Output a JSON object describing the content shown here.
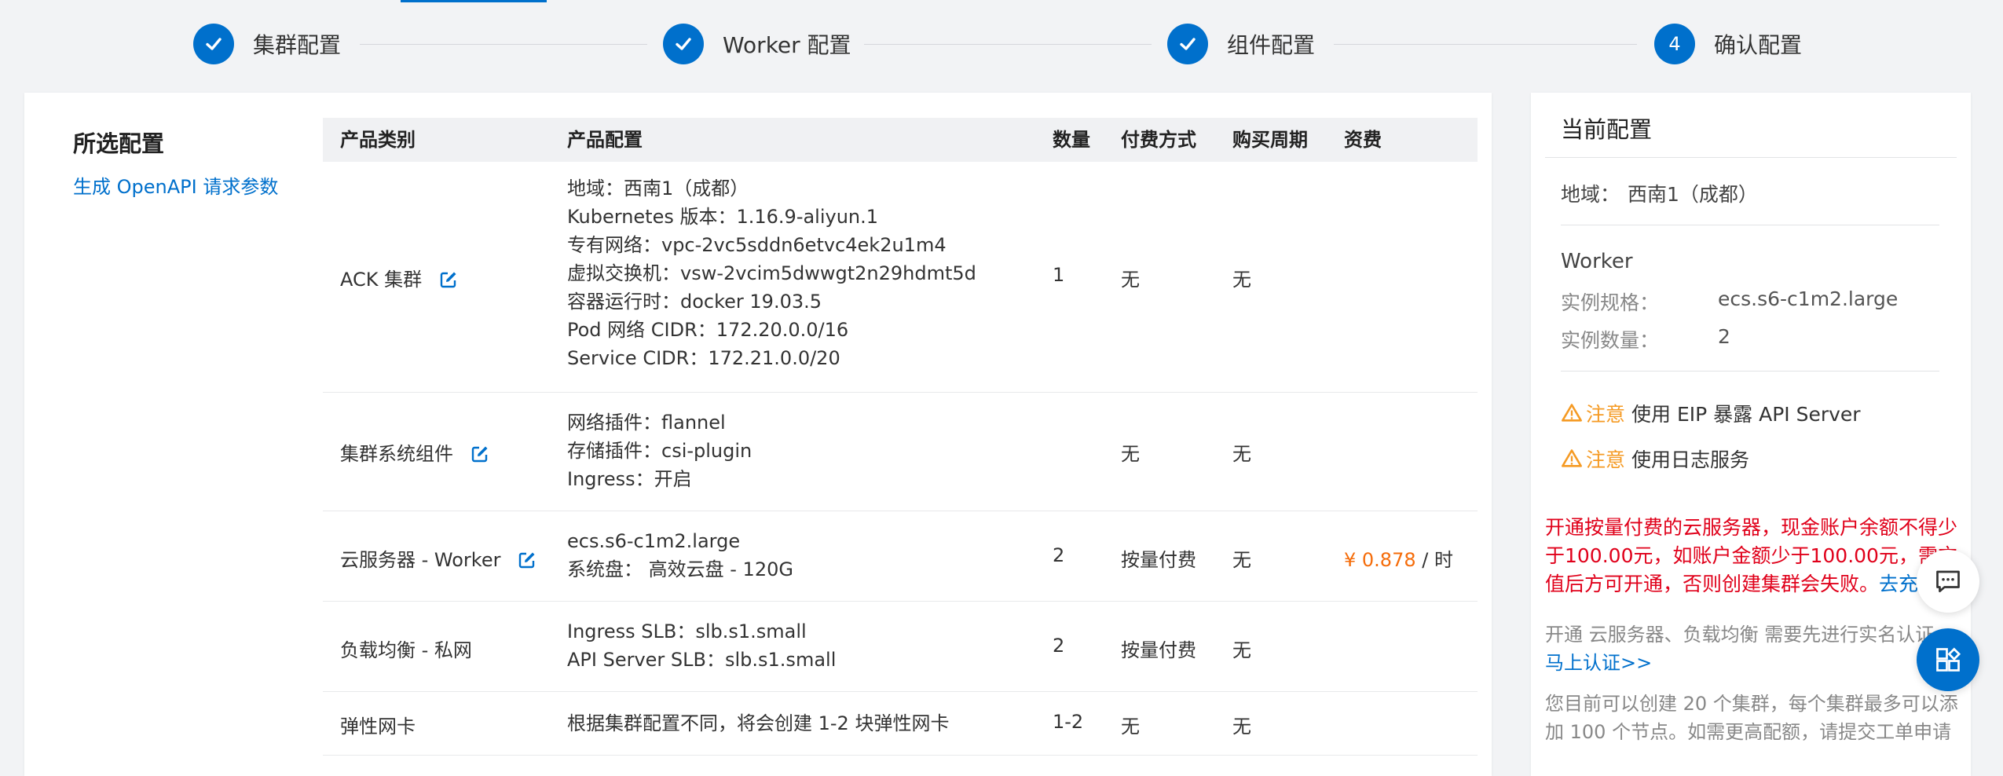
{
  "steps": [
    {
      "label": "集群配置"
    },
    {
      "label": "Worker 配置"
    },
    {
      "label": "组件配置"
    },
    {
      "num": "4",
      "label": "确认配置"
    }
  ],
  "selection": {
    "title": "所选配置",
    "openapi_link": "生成 OpenAPI 请求参数"
  },
  "table": {
    "headers": [
      "产品类别",
      "产品配置",
      "数量",
      "付费方式",
      "购买周期",
      "资费"
    ],
    "rows": [
      {
        "category": "ACK 集群",
        "config": [
          "地域：西南1（成都）",
          "Kubernetes 版本：1.16.9-aliyun.1",
          "专有网络：vpc-2vc5sddn6etvc4ek2u1m4",
          "虚拟交换机：vsw-2vcim5dwwgt2n29hdmt5d",
          "容器运行时：docker 19.03.5",
          "Pod 网络 CIDR：172.20.0.0/16",
          "Service CIDR：172.21.0.0/20"
        ],
        "qty": "1",
        "payment": "无",
        "period": "无",
        "price": "",
        "price_unit": ""
      },
      {
        "category": "集群系统组件",
        "config": [
          "网络插件：flannel",
          "存储插件：csi-plugin",
          "Ingress：开启"
        ],
        "qty": "",
        "payment": "无",
        "period": "无",
        "price": "",
        "price_unit": ""
      },
      {
        "category": "云服务器 - Worker",
        "config": [
          "ecs.s6-c1m2.large",
          "系统盘： 高效云盘 - 120G"
        ],
        "qty": "2",
        "payment": "按量付费",
        "period": "无",
        "price": "¥ 0.878",
        "price_unit": " / 时"
      },
      {
        "category": "负载均衡 - 私网",
        "config": [
          "Ingress SLB：slb.s1.small",
          "API Server SLB：slb.s1.small"
        ],
        "qty": "2",
        "payment": "按量付费",
        "period": "无",
        "price": "",
        "price_unit": ""
      },
      {
        "category": "弹性网卡",
        "config": [
          "根据集群配置不同，将会创建 1-2 块弹性网卡"
        ],
        "qty": "1-2",
        "payment": "无",
        "period": "无",
        "price": "",
        "price_unit": ""
      }
    ]
  },
  "current": {
    "title": "当前配置",
    "region_key": "地域：",
    "region_val": "西南1（成都）",
    "worker_title": "Worker",
    "spec_key": "实例规格：",
    "spec_val": "ecs.s6-c1m2.large",
    "count_key": "实例数量：",
    "count_val": "2",
    "warn_label": "注意",
    "warn1": "使用 EIP 暴露 API Server",
    "warn2": "使用日志服务",
    "red_notice": "开通按量付费的云服务器，现金账户余额不得少于100.00元，如账户金额少于100.00元，需充值后方可开通，否则创建集群会失败。",
    "recharge_link": "去充值",
    "realname_notice": "开通 云服务器、负载均衡 需要先进行实名认证",
    "realname_link": "马上认证>>",
    "quota_notice": "您目前可以创建 20 个集群，每个集群最多可以添加 100 个节点。如需更高配额，请提交工单申请"
  },
  "colors": {
    "accent": "#0070cc",
    "warning": "#f59a23",
    "price": "#f56c0a",
    "error": "#e0001a"
  }
}
